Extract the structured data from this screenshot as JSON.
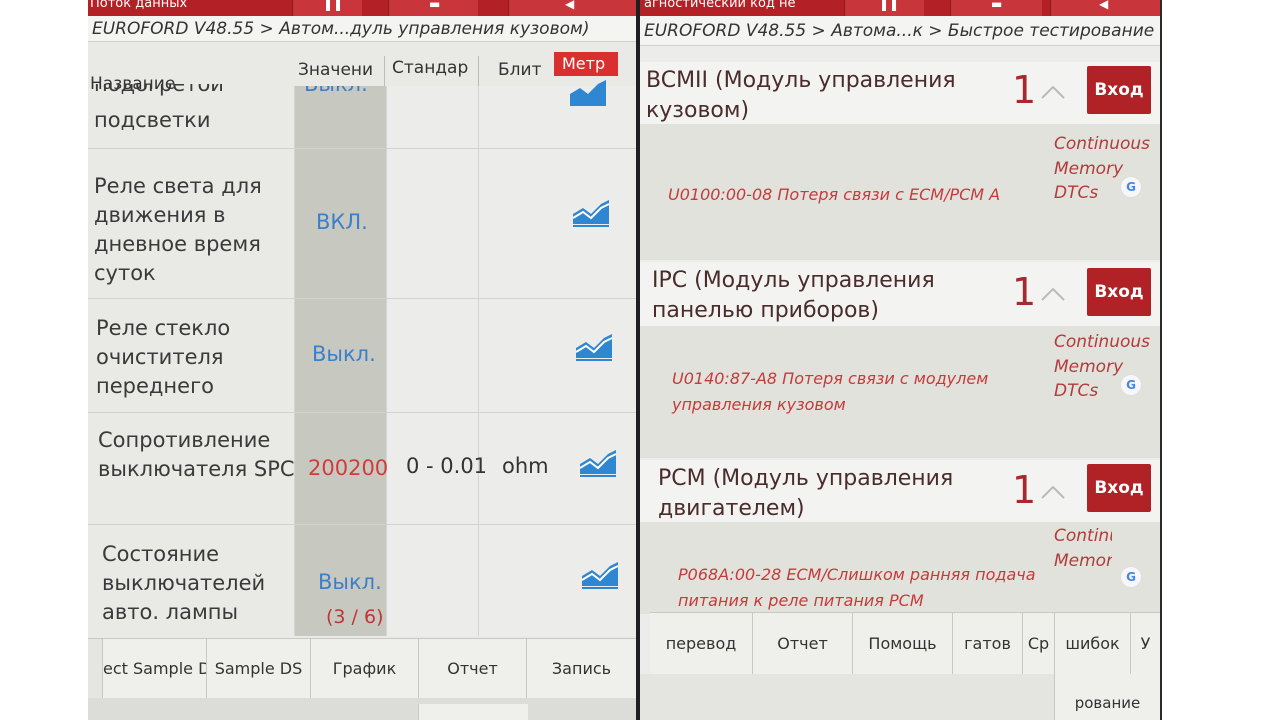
{
  "left": {
    "topbar": {
      "title": "Поток данных"
    },
    "breadcrumb": "EUROFORD V48.55 > Автом...дуль управления кузовом)",
    "columns": {
      "name": "Название",
      "value": "Значени",
      "standard": "Стандар",
      "unit": "Блит",
      "metric": "Метр"
    },
    "rows": [
      {
        "name": "подогретой подсветки",
        "name_top": "подогретой",
        "name_bottom": "подсветки",
        "value": "Выкл.",
        "standard": "",
        "unit": ""
      },
      {
        "name": "Реле света для движения в дневное время суток",
        "value": "ВКЛ.",
        "standard": "",
        "unit": ""
      },
      {
        "name": "Реле стекло очистителя переднего",
        "value": "Выкл.",
        "standard": "",
        "unit": ""
      },
      {
        "name": "Сопротивление выключателя SPC",
        "value": "200200",
        "standard": "0 - 0.01",
        "unit": "ohm"
      },
      {
        "name": "Состояние выключателей авто. лампы",
        "value": "Выкл.",
        "standard": "",
        "unit": ""
      }
    ],
    "page_indicator": "(3 / 6)",
    "bottom_buttons": [
      "ect Sample D",
      "Sample DS",
      "График",
      "Отчет",
      "Запись"
    ]
  },
  "right": {
    "topbar": {
      "title": "агностический код не"
    },
    "breadcrumb": "EUROFORD V48.55 > Автома...к > Быстрое тестирование",
    "enter_label": "Вход",
    "modules": [
      {
        "title": "BCMII (Модуль управления кузовом)",
        "count": "1",
        "dtc": "U0100:00-08 Потеря связи с ECM/PCM A",
        "dtc_type": "Continuous Memory DTCs"
      },
      {
        "title": "IPC (Модуль управления панелью приборов)",
        "count": "1",
        "dtc": "U0140:87-A8 Потеря связи с модулем управления кузовом",
        "dtc_type": "Continuous Memory DTCs"
      },
      {
        "title": "PCM (Модуль управления двигателем)",
        "count": "1",
        "dtc": "P068A:00-28 ECM/Слишком ранняя подача питания к реле питания PCM",
        "dtc_type": "Continuous Memory"
      }
    ],
    "bottom_buttons": [
      "перевод",
      "Отчет",
      "Помощь",
      "гатов",
      "Ср",
      "шибок",
      "У"
    ],
    "sub_button": "рование"
  },
  "colors": {
    "brand_red": "#b32025",
    "value_blue": "#3b7fcb",
    "alert_red": "#d33b3b",
    "graph_blue": "#2f86d1"
  },
  "icons": {
    "graph": "trend-chart-icon",
    "chevron": "chevron-up-icon",
    "translate": "google-translate-icon"
  }
}
